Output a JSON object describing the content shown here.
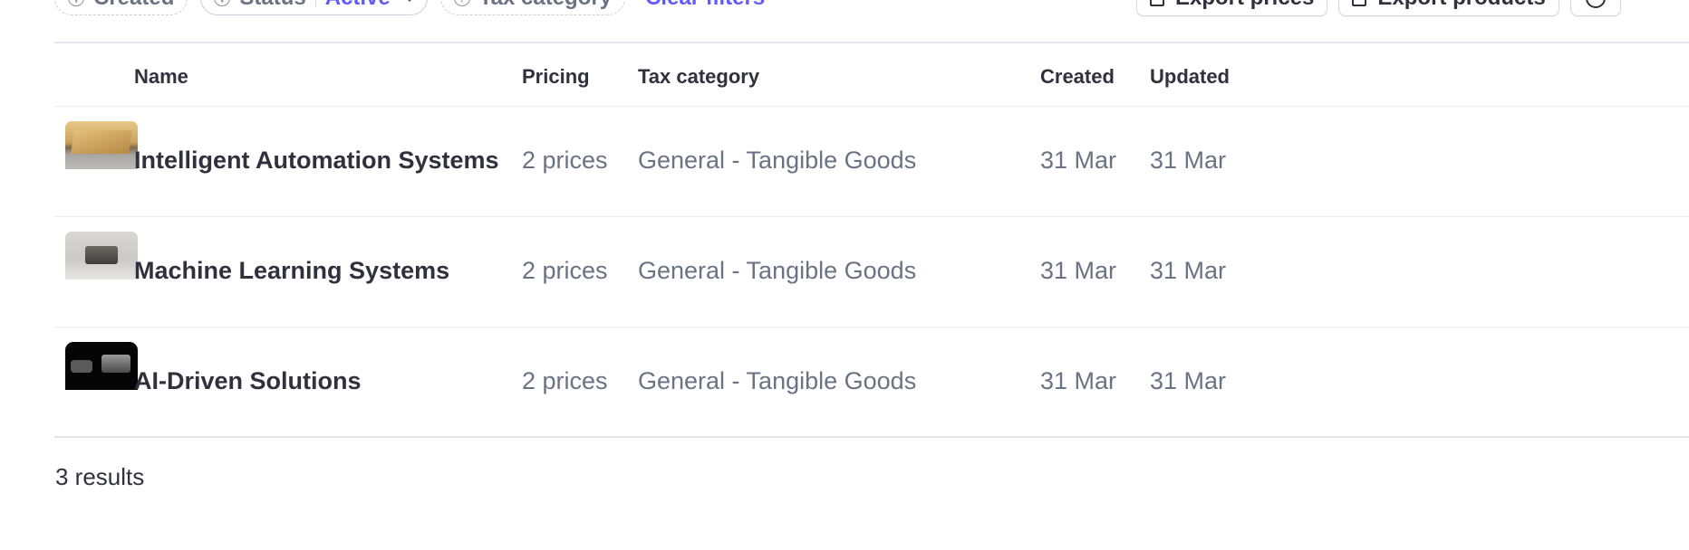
{
  "filters": {
    "created_label": "Created",
    "status_label": "Status",
    "status_value": "Active",
    "tax_category_label": "Tax category",
    "clear_filters_label": "Clear filters"
  },
  "toolbar": {
    "export_prices_label": "Export prices",
    "export_products_label": "Export products"
  },
  "table": {
    "columns": {
      "name": "Name",
      "pricing": "Pricing",
      "tax_category": "Tax category",
      "created": "Created",
      "updated": "Updated"
    },
    "rows": [
      {
        "name": "Intelligent Automation Systems",
        "pricing": "2 prices",
        "tax_category": "General - Tangible Goods",
        "created": "31 Mar",
        "updated": "31 Mar"
      },
      {
        "name": "Machine Learning Systems",
        "pricing": "2 prices",
        "tax_category": "General - Tangible Goods",
        "created": "31 Mar",
        "updated": "31 Mar"
      },
      {
        "name": "AI-Driven Solutions",
        "pricing": "2 prices",
        "tax_category": "General - Tangible Goods",
        "created": "31 Mar",
        "updated": "31 Mar"
      }
    ]
  },
  "results_count": "3 results",
  "colors": {
    "accent": "#625afa",
    "text_primary": "#30313d",
    "text_secondary": "#6a7383",
    "border": "#ebeef1"
  },
  "icons": {
    "filter_chip": "plus-circle-icon",
    "export": "document-icon",
    "settings": "gear-icon"
  }
}
